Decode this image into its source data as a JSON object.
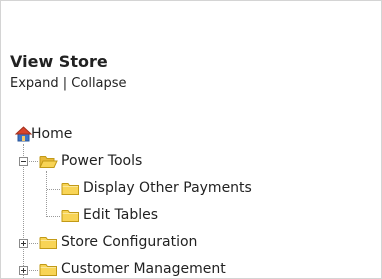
{
  "panel": {
    "title": "View Store",
    "expand_label": "Expand",
    "separator": "|",
    "collapse_label": "Collapse"
  },
  "tree": {
    "root": {
      "label": "Home",
      "icon": "home-icon"
    },
    "nodes": [
      {
        "label": "Power Tools",
        "icon": "folder-open-icon",
        "state": "expanded"
      },
      {
        "label": "Display Other Payments",
        "icon": "folder-icon"
      },
      {
        "label": "Edit Tables",
        "icon": "folder-icon"
      },
      {
        "label": "Store Configuration",
        "icon": "folder-icon",
        "state": "collapsed"
      },
      {
        "label": "Customer Management",
        "icon": "folder-icon",
        "state": "collapsed"
      }
    ]
  },
  "colors": {
    "folder_fill": "#f8d456",
    "folder_stroke": "#c29a17",
    "tree_line": "#9a9a9a",
    "home_roof": "#d9442c",
    "home_wall": "#3b74c9"
  }
}
